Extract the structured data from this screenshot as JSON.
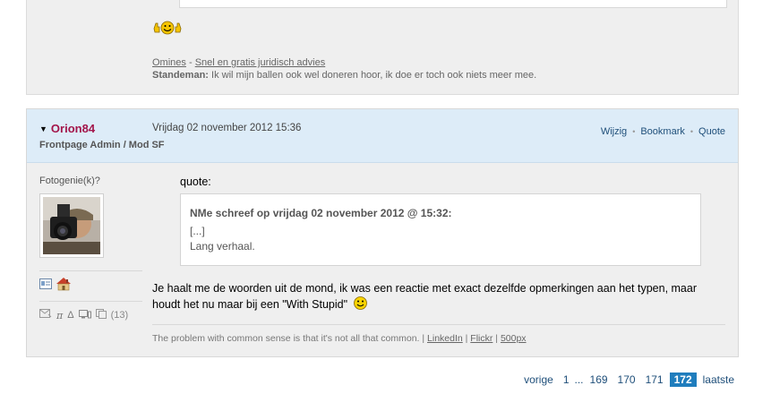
{
  "prev_post": {
    "sig_links": [
      "Omines",
      "Snel en gratis juridisch advies"
    ],
    "sig_separator": " - ",
    "sig_author": "Standeman:",
    "sig_text": " Ik wil mijn ballen ook wel doneren hoor, ik doe er toch ook niets meer mee."
  },
  "post": {
    "username": "Orion84",
    "role": "Frontpage Admin / Mod SF",
    "date": "Vrijdag 02 november 2012 15:36",
    "actions": [
      "Wijzig",
      "Bookmark",
      "Quote"
    ],
    "user_title": "Fotogenie(k)?",
    "quote_label": "quote:",
    "quote_header": "NMe schreef op vrijdag 02 november 2012 @ 15:32:",
    "quote_lines": [
      "[...]",
      "Lang verhaal."
    ],
    "message": "Je haalt me de woorden uit de mond, ik was een reactie met exact dezelfde opmerkingen aan het typen, maar houdt het nu maar bij een \"With Stupid\"",
    "review_count": "(13)",
    "sig_text": "The problem with common sense is that it's not all that common. | ",
    "sig_links": [
      "LinkedIn",
      "Flickr",
      "500px"
    ],
    "sig_sep": " | "
  },
  "pager": {
    "prev": "vorige",
    "first": "1",
    "ellipsis": "...",
    "pages": [
      "169",
      "170",
      "171"
    ],
    "current": "172",
    "last": "laatste"
  },
  "colors": {
    "username": "#a3154a",
    "header_bg": "#ddecf8",
    "post_bg": "#efefef",
    "link": "#1f4f7a",
    "current_page": "#1f7dbd"
  }
}
